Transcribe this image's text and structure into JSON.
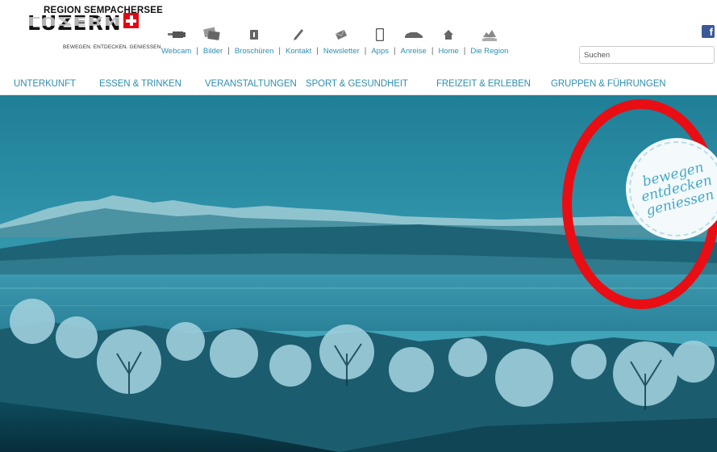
{
  "logo": {
    "region": "REGION SEMPACHERSEE",
    "name": "LUZERN",
    "tagline": "BEWEGEN. ENTDECKEN. GENIESSEN."
  },
  "utility_nav": [
    {
      "label": "Webcam",
      "icon": "webcam-icon"
    },
    {
      "label": "Bilder",
      "icon": "images-icon"
    },
    {
      "label": "Broschüren",
      "icon": "brochure-icon"
    },
    {
      "label": "Kontakt",
      "icon": "pen-icon"
    },
    {
      "label": "Newsletter",
      "icon": "envelope-icon"
    },
    {
      "label": "Apps",
      "icon": "smartphone-icon"
    },
    {
      "label": "Anreise",
      "icon": "car-icon"
    },
    {
      "label": "Home",
      "icon": "home-icon"
    },
    {
      "label": "Die Region",
      "icon": "region-map-icon"
    }
  ],
  "separator": "|",
  "search": {
    "placeholder": "Suchen"
  },
  "social": {
    "facebook": "f"
  },
  "main_nav": [
    "UNTERKUNFT",
    "ESSEN & TRINKEN",
    "VERANSTALTUNGEN",
    "SPORT & GESUNDHEIT",
    "FREIZEIT & ERLEBEN",
    "GRUPPEN & FÜHRUNGEN"
  ],
  "hero": {
    "stamp": [
      "bewegen",
      "entdecken",
      "geniessen"
    ]
  },
  "colors": {
    "link": "#2e8fb0",
    "hero_tint": "#2a8fa6",
    "highlight_ring": "#e80e14",
    "logo_cross": "#e30613"
  }
}
